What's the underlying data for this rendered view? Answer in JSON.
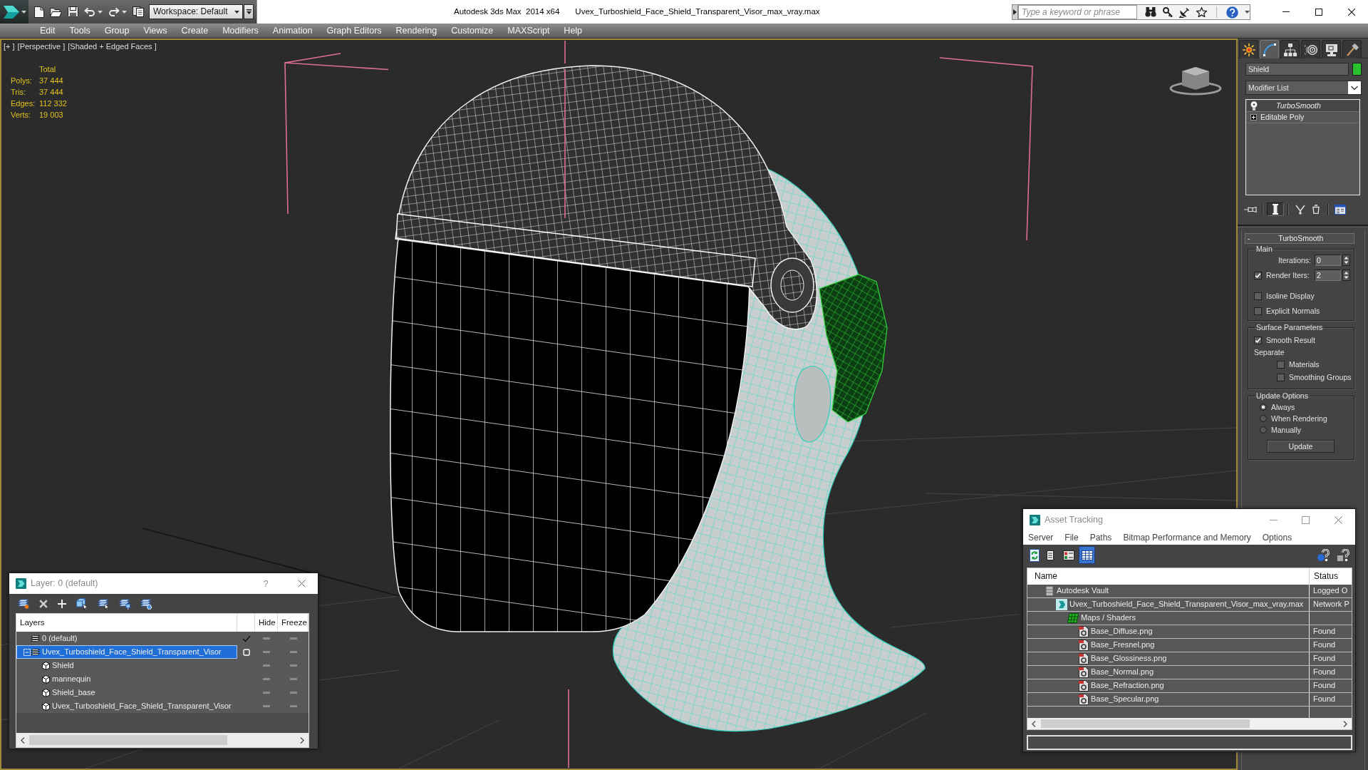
{
  "title_bar": {
    "workspace": "Workspace: Default",
    "app_title": "Autodesk 3ds Max  2014 x64",
    "file_name": "Uvex_Turboshield_Face_Shield_Transparent_Visor_max_vray.max",
    "search": {
      "placeholder": "Type a keyword or phrase"
    }
  },
  "menu_bar": [
    "Edit",
    "Tools",
    "Group",
    "Views",
    "Create",
    "Modifiers",
    "Animation",
    "Graph Editors",
    "Rendering",
    "Customize",
    "MAXScript",
    "Help"
  ],
  "viewport": {
    "labels": [
      "[+ ]",
      "[Perspective ]",
      "[Shaded + Edged Faces ]"
    ],
    "stats": {
      "header": "Total",
      "rows": [
        {
          "label": "Polys:",
          "value": "37 444"
        },
        {
          "label": "Tris:",
          "value": "37 444"
        },
        {
          "label": "Edges:",
          "value": "112 332"
        },
        {
          "label": "Verts:",
          "value": "19 003"
        }
      ]
    }
  },
  "command_panel": {
    "tabs": [
      {
        "kind": "create",
        "selected": false
      },
      {
        "kind": "modify",
        "selected": true
      },
      {
        "kind": "hierarchy",
        "selected": false
      },
      {
        "kind": "motion",
        "selected": false
      },
      {
        "kind": "display",
        "selected": false
      },
      {
        "kind": "utilities",
        "selected": false
      }
    ],
    "object_name": "Shield",
    "modifier_list": "Modifier List",
    "stack": [
      {
        "name": "TurboSmooth",
        "kind": "modifier",
        "selected": true,
        "enabled": true
      },
      {
        "name": "Editable Poly",
        "kind": "base",
        "selected": false,
        "expanded": false
      }
    ],
    "stack_tools": [
      {
        "kind": "pin",
        "pressed": false
      },
      {
        "kind": "show-end-result",
        "pressed": true
      },
      {
        "kind": "make-unique",
        "pressed": false
      },
      {
        "kind": "remove",
        "pressed": false
      },
      {
        "kind": "configure",
        "pressed": false
      }
    ],
    "rollout": {
      "title": "TurboSmooth",
      "toggle": "-",
      "groups": [
        {
          "title": "Main",
          "controls": [
            {
              "kind": "spinner",
              "label": "Iterations:",
              "value": "0"
            },
            {
              "kind": "check-spinner",
              "label": "Render Iters:",
              "checked": true,
              "value": "2"
            },
            {
              "kind": "checkbox",
              "label": "Isoline Display",
              "checked": false
            },
            {
              "kind": "checkbox",
              "label": "Explicit Normals",
              "checked": false
            }
          ]
        },
        {
          "title": "Surface Parameters",
          "controls": [
            {
              "kind": "checkbox",
              "label": "Smooth Result",
              "checked": true
            },
            {
              "kind": "subgroup",
              "label": "Separate",
              "children": [
                {
                  "kind": "checkbox",
                  "label": "Materials",
                  "checked": false
                },
                {
                  "kind": "checkbox",
                  "label": "Smoothing Groups",
                  "checked": false
                }
              ]
            }
          ]
        },
        {
          "title": "Update Options",
          "controls": [
            {
              "kind": "radio",
              "label": "Always",
              "selected": true
            },
            {
              "kind": "radio",
              "label": "When Rendering",
              "selected": false
            },
            {
              "kind": "radio",
              "label": "Manually",
              "selected": false
            },
            {
              "kind": "button",
              "label": "Update"
            }
          ]
        }
      ]
    }
  },
  "layer_dialog": {
    "title": "Layer: 0 (default)",
    "help": "?",
    "columns": [
      "Layers",
      "Hide",
      "Freeze"
    ],
    "layers": [
      {
        "name": "0 (default)",
        "kind": "layer",
        "selected": false,
        "current": true,
        "hidden": false,
        "frozen": false
      },
      {
        "name": "Uvex_Turboshield_Face_Shield_Transparent_Visor",
        "kind": "layer",
        "selected": true,
        "current": false,
        "expanded": true,
        "hidden": false,
        "frozen": false,
        "children": [
          {
            "name": "Shield",
            "kind": "object",
            "selected": false,
            "hidden": false,
            "frozen": false
          },
          {
            "name": "mannequin",
            "kind": "object",
            "selected": false,
            "hidden": false,
            "frozen": false
          },
          {
            "name": "Shield_base",
            "kind": "object",
            "selected": false,
            "hidden": false,
            "frozen": false
          },
          {
            "name": "Uvex_Turboshield_Face_Shield_Transparent_Visor",
            "kind": "object",
            "selected": false,
            "hidden": false,
            "frozen": false
          }
        ]
      }
    ]
  },
  "asset_tracking": {
    "title": "Asset Tracking",
    "menu": [
      "Server",
      "File",
      "Paths",
      "Bitmap Performance and Memory",
      "Options"
    ],
    "views": [
      {
        "kind": "list",
        "selected": false
      },
      {
        "kind": "thumbnails",
        "selected": false
      },
      {
        "kind": "table",
        "selected": true
      }
    ],
    "columns": [
      "Name",
      "Status"
    ],
    "rows": [
      {
        "name": "Autodesk Vault",
        "kind": "vault",
        "status": "Logged O",
        "selected": false,
        "children": [
          {
            "name": "Uvex_Turboshield_Face_Shield_Transparent_Visor_max_vray.max",
            "kind": "scene",
            "status": "Network P",
            "selected": false,
            "children": [
              {
                "name": "Maps / Shaders",
                "kind": "folder",
                "selected": false,
                "children": [
                  {
                    "name": "Base_Diffuse.png",
                    "kind": "bitmap",
                    "status": "Found",
                    "selected": false
                  },
                  {
                    "name": "Base_Fresnel.png",
                    "kind": "bitmap",
                    "status": "Found",
                    "selected": false
                  },
                  {
                    "name": "Base_Glossiness.png",
                    "kind": "bitmap",
                    "status": "Found",
                    "selected": false
                  },
                  {
                    "name": "Base_Normal.png",
                    "kind": "bitmap",
                    "status": "Found",
                    "selected": false
                  },
                  {
                    "name": "Base_Refraction.png",
                    "kind": "bitmap",
                    "status": "Found",
                    "selected": false
                  },
                  {
                    "name": "Base_Specular.png",
                    "kind": "bitmap",
                    "status": "Found",
                    "selected": false
                  }
                ]
              }
            ]
          }
        ]
      }
    ]
  }
}
